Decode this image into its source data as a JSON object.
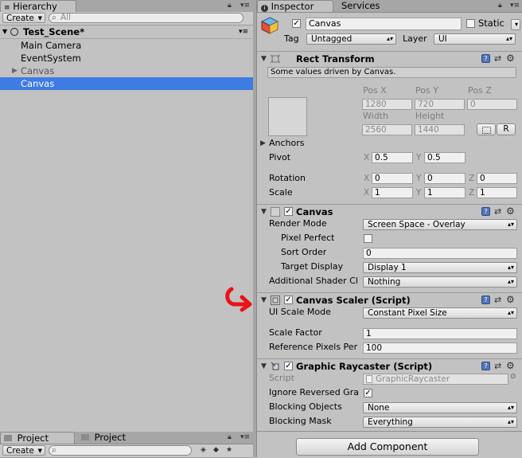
{
  "hierarchy": {
    "tab_label": "Hierarchy",
    "create_label": "Create",
    "search_placeholder": "All",
    "scene_name": "Test_Scene*",
    "items": [
      {
        "label": "Main Camera"
      },
      {
        "label": "EventSystem"
      },
      {
        "label": "Canvas"
      },
      {
        "label": "Canvas"
      }
    ]
  },
  "project": {
    "tabs": [
      {
        "label": "Project"
      },
      {
        "label": "Project"
      }
    ],
    "create_label": "Create"
  },
  "inspector": {
    "tabs": [
      {
        "label": "Inspector"
      },
      {
        "label": "Services"
      }
    ],
    "object_name": "Canvas",
    "static_label": "Static",
    "tag_label": "Tag",
    "tag_value": "Untagged",
    "layer_label": "Layer",
    "layer_value": "UI",
    "rect_transform": {
      "title": "Rect Transform",
      "driven_note": "Some values driven by Canvas.",
      "pos_x_label": "Pos X",
      "pos_y_label": "Pos Y",
      "pos_z_label": "Pos Z",
      "pos_x": "1280",
      "pos_y": "720",
      "pos_z": "0",
      "width_label": "Width",
      "height_label": "Height",
      "width": "2560",
      "height": "1440",
      "raw_button": "R",
      "anchors_label": "Anchors",
      "pivot_label": "Pivot",
      "pivot_x": "0.5",
      "pivot_y": "0.5",
      "rotation_label": "Rotation",
      "rot_x": "0",
      "rot_y": "0",
      "rot_z": "0",
      "scale_label": "Scale",
      "scale_x": "1",
      "scale_y": "1",
      "scale_z": "1",
      "axis_x": "X",
      "axis_y": "Y",
      "axis_z": "Z"
    },
    "canvas": {
      "title": "Canvas",
      "render_mode_label": "Render Mode",
      "render_mode": "Screen Space - Overlay",
      "pixel_perfect_label": "Pixel Perfect",
      "sort_order_label": "Sort Order",
      "sort_order": "0",
      "target_display_label": "Target Display",
      "target_display": "Display 1",
      "shader_channels_label": "Additional Shader Cl",
      "shader_channels": "Nothing"
    },
    "canvas_scaler": {
      "title": "Canvas Scaler (Script)",
      "ui_scale_mode_label": "UI Scale Mode",
      "ui_scale_mode": "Constant Pixel Size",
      "scale_factor_label": "Scale Factor",
      "scale_factor": "1",
      "ref_ppu_label": "Reference Pixels Per",
      "ref_ppu": "100"
    },
    "graphic_raycaster": {
      "title": "Graphic Raycaster (Script)",
      "script_label": "Script",
      "script_value": "GraphicRaycaster",
      "ignore_reversed_label": "Ignore Reversed Gra",
      "blocking_objects_label": "Blocking Objects",
      "blocking_objects": "None",
      "blocking_mask_label": "Blocking Mask",
      "blocking_mask": "Everything"
    },
    "add_component_label": "Add Component"
  },
  "colors": {
    "selection": "#3e7ce4",
    "panel": "#c2c2c2",
    "annotation_arrow": "#e8141b"
  }
}
